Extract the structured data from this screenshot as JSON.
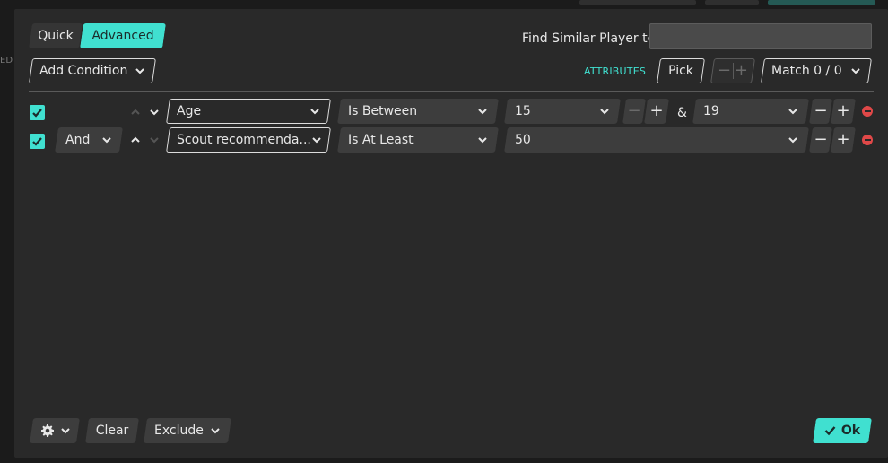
{
  "background": {
    "side_text": "ED"
  },
  "tabs": {
    "quick": "Quick",
    "advanced": "Advanced"
  },
  "find_similar": {
    "label": "Find Similar Player to",
    "value": ""
  },
  "toolbar": {
    "add_condition": "Add Condition",
    "attributes": "ATTRIBUTES",
    "pick": "Pick",
    "match": "Match 0 / 0"
  },
  "conditions": [
    {
      "checked": true,
      "connector": "",
      "field": "Age",
      "operator": "Is Between",
      "value1": "15",
      "separator": "&",
      "value2": "19"
    },
    {
      "checked": true,
      "connector": "And",
      "field": "Scout recommenda...",
      "operator": "Is At Least",
      "value1": "50"
    }
  ],
  "footer": {
    "clear": "Clear",
    "exclude": "Exclude",
    "ok": "Ok"
  },
  "colors": {
    "accent": "#40e0d0",
    "remove": "#e04848",
    "panel": "#292929"
  }
}
